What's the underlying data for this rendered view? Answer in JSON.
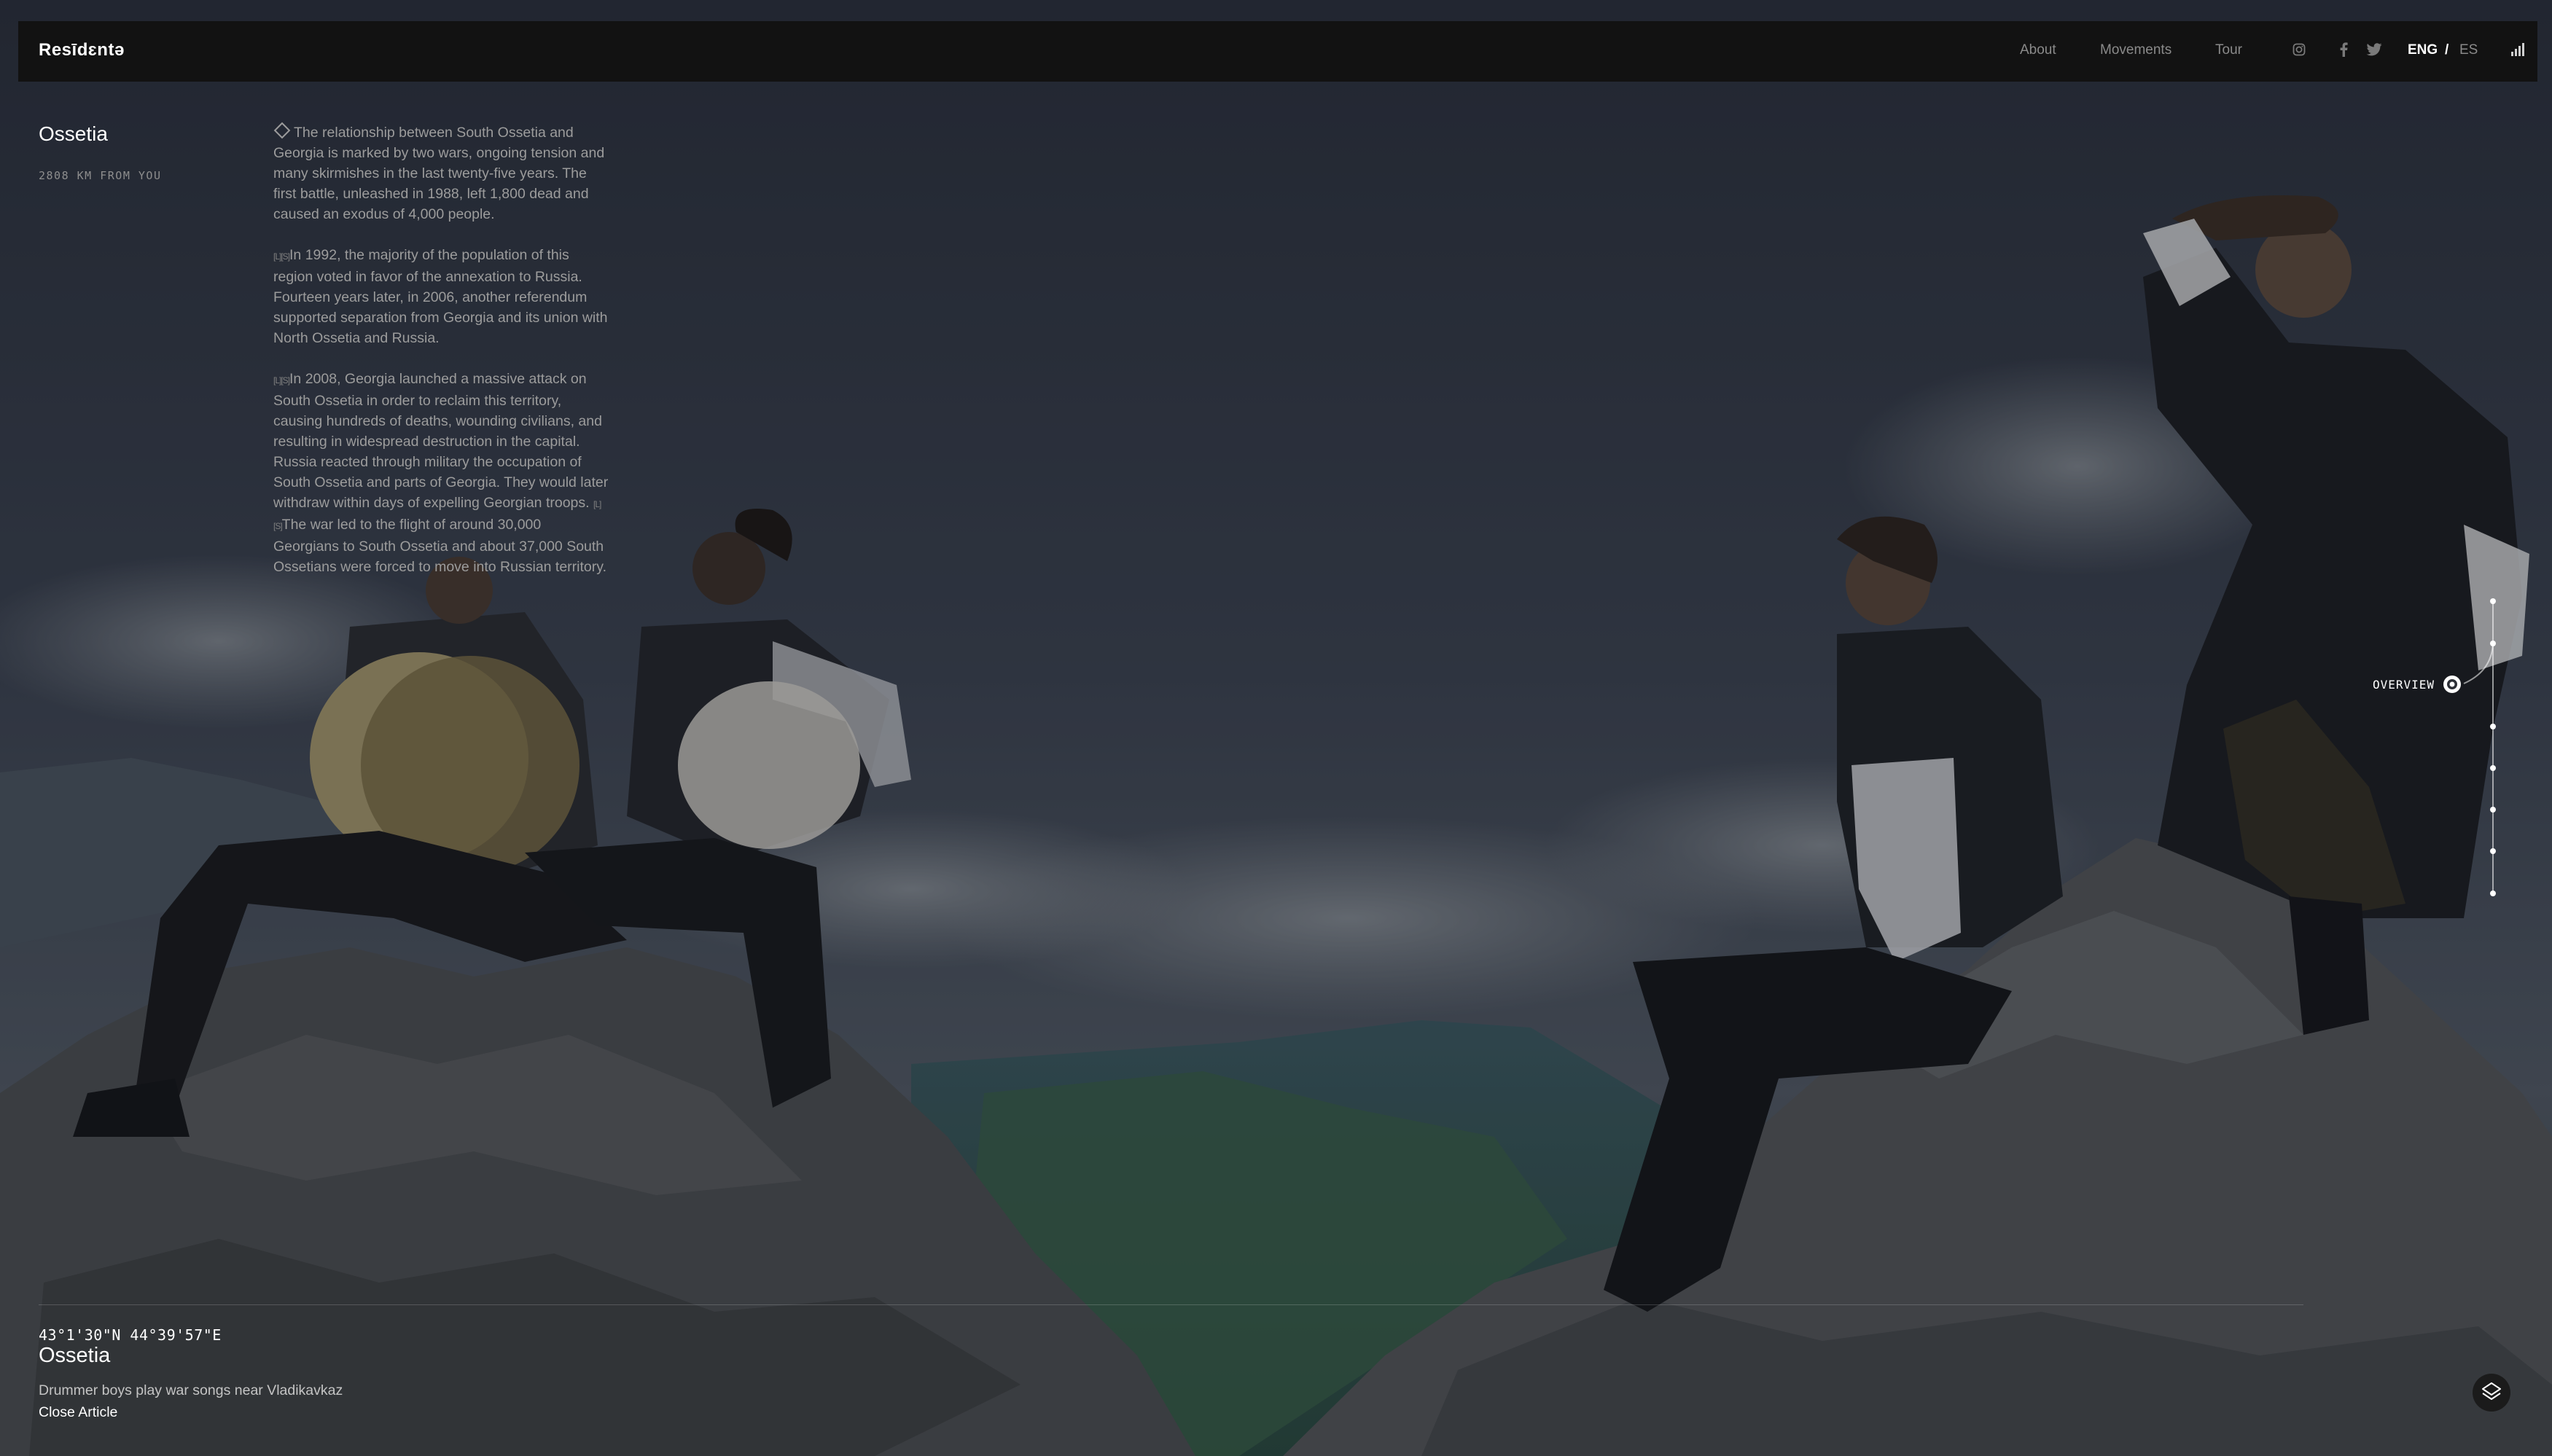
{
  "app": {
    "logo": "Resīdɛntə"
  },
  "nav": {
    "links": [
      "About",
      "Movements",
      "Tour"
    ],
    "social": [
      "instagram-icon",
      "facebook-icon",
      "twitter-icon"
    ],
    "lang_active": "ENG",
    "lang_separator": "/",
    "lang_other": "ES",
    "signal_icon": "signal-bars-icon"
  },
  "location": {
    "title": "Ossetia",
    "distance": "2808 KM FROM YOU"
  },
  "article": {
    "paragraph_1": "The relationship between South Ossetia and Georgia is marked by two wars, ongoing tension and many skirmishes in the last twenty-five years. The first battle, unleashed in 1988, left 1,800 dead and caused an exodus of 4,000 people.",
    "paragraph_2": "In 1992, the majority of the population of this region voted in favor of the annexation to Russia. Fourteen years later, in 2006, another referendum supported separation from Georgia and its union with North Ossetia and Russia.",
    "paragraph_3a": "In 2008, Georgia launched a massive attack on South Ossetia in order to reclaim this territory, causing hundreds of deaths, wounding civilians, and resulting in widespread destruction in the capital. Russia reacted through military the occupation of South Ossetia and parts of Georgia. They would later withdraw within days of expelling Georgian troops.",
    "paragraph_3b": "The war led to the flight of around 30,000 Georgians to South Ossetia and about 37,000 South Ossetians were forced to move into Russian territory.",
    "glyph": "[L][S]"
  },
  "timeline": {
    "active_label": "OVERVIEW"
  },
  "caption": {
    "coordinates": "43°1'30\"N 44°39'57\"E",
    "title": "Ossetia",
    "text": "Drummer boys play war songs near Vladikavkaz",
    "close_label": "Close Article"
  },
  "colors": {
    "navbar": "#121212",
    "text_primary": "#ffffff",
    "text_muted": "#9c9c9c"
  }
}
